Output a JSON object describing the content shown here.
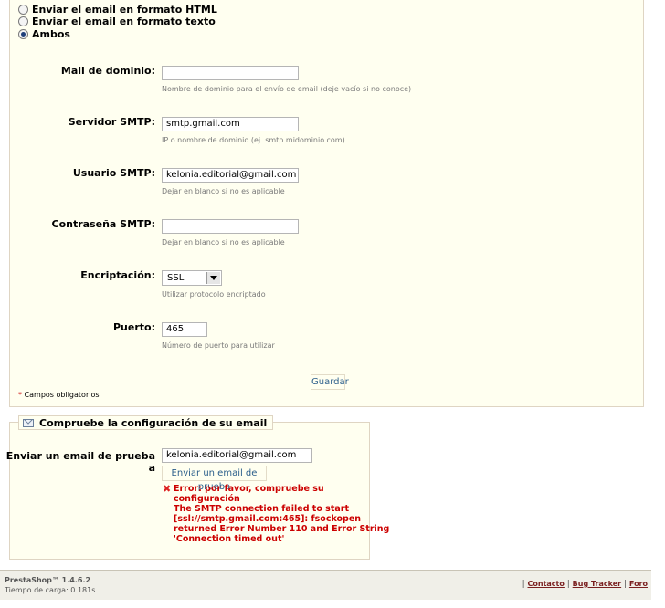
{
  "email_format": {
    "options": [
      {
        "label": "Enviar el email en formato HTML",
        "checked": false
      },
      {
        "label": "Enviar el email en formato texto",
        "checked": false
      },
      {
        "label": "Ambos",
        "checked": true
      }
    ]
  },
  "fields": {
    "domain": {
      "label": "Mail de dominio:",
      "value": "",
      "hint": "Nombre de dominio para el envío de email (deje vacío si no conoce)"
    },
    "smtp_server": {
      "label": "Servidor SMTP:",
      "value": "smtp.gmail.com",
      "hint": "IP o nombre de dominio (ej. smtp.midominio.com)"
    },
    "smtp_user": {
      "label": "Usuario SMTP:",
      "value": "kelonia.editorial@gmail.com",
      "hint": "Dejar en blanco si no es aplicable"
    },
    "smtp_password": {
      "label": "Contraseña SMTP:",
      "value": "",
      "hint": "Dejar en blanco si no es aplicable"
    },
    "encryption": {
      "label": "Encriptación:",
      "value": "SSL",
      "hint": "Utilizar protocolo encriptado"
    },
    "port": {
      "label": "Puerto:",
      "value": "465",
      "hint": "Número de puerto para utilizar"
    }
  },
  "save_button": "Guardar",
  "required_note": {
    "star": "*",
    "text": "Campos obligatorios"
  },
  "test_panel": {
    "title": "Compruebe la configuración de su email",
    "label": "Enviar un email de prueba a",
    "value": "kelonia.editorial@gmail.com",
    "button": "Enviar un email de prueba",
    "error_lines": [
      "Error: por favor, compruebe su",
      "configuración",
      "The SMTP connection failed to start",
      "[ssl://smtp.gmail.com:465]: fsockopen",
      "returned Error Number 110 and Error String",
      "'Connection timed out'"
    ]
  },
  "footer": {
    "version": "PrestaShop™ 1.4.6.2",
    "load_time": "Tiempo de carga: 0.181s",
    "separator": "|",
    "links": [
      "Contacto",
      "Bug Tracker",
      "Foro"
    ]
  }
}
